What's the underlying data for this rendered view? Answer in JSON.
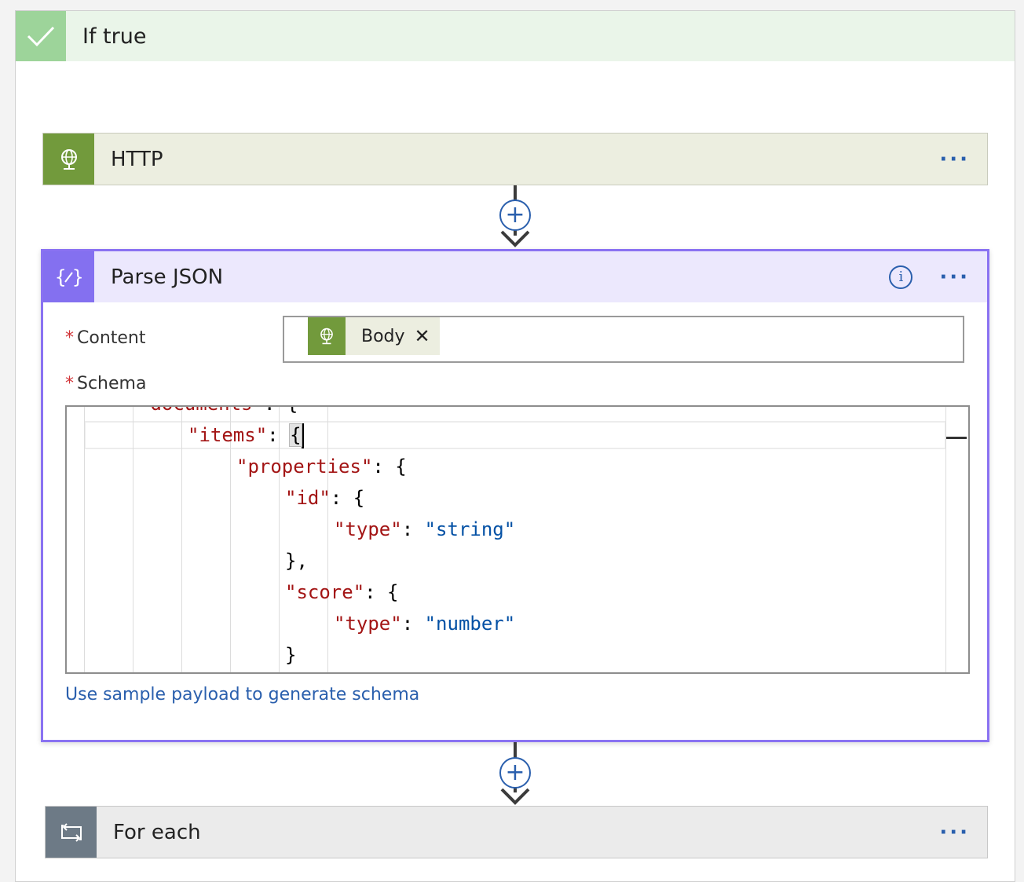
{
  "condition": {
    "title": "If true"
  },
  "http_action": {
    "title": "HTTP",
    "more": "···"
  },
  "parse_action": {
    "title": "Parse JSON",
    "info": "i",
    "more": "···",
    "content_label": "Content",
    "content_token": {
      "label": "Body",
      "remove": "✕"
    },
    "schema_label": "Schema",
    "required_mark": "*",
    "schema_lines": [
      {
        "indent": 2,
        "parts": [
          {
            "c": "k",
            "t": "\"documents\""
          },
          {
            "c": "p",
            "t": ": {"
          }
        ]
      },
      {
        "indent": 3,
        "parts": [
          {
            "c": "k",
            "t": "\"items\""
          },
          {
            "c": "p",
            "t": ": "
          }
        ],
        "bracket": "{"
      },
      {
        "indent": 4,
        "parts": [
          {
            "c": "k",
            "t": "\"properties\""
          },
          {
            "c": "p",
            "t": ": {"
          }
        ]
      },
      {
        "indent": 5,
        "parts": [
          {
            "c": "k",
            "t": "\"id\""
          },
          {
            "c": "p",
            "t": ": {"
          }
        ]
      },
      {
        "indent": 6,
        "parts": [
          {
            "c": "k",
            "t": "\"type\""
          },
          {
            "c": "p",
            "t": ": "
          },
          {
            "c": "s",
            "t": "\"string\""
          }
        ]
      },
      {
        "indent": 5,
        "parts": [
          {
            "c": "p",
            "t": "},"
          }
        ]
      },
      {
        "indent": 5,
        "parts": [
          {
            "c": "k",
            "t": "\"score\""
          },
          {
            "c": "p",
            "t": ": {"
          }
        ]
      },
      {
        "indent": 6,
        "parts": [
          {
            "c": "k",
            "t": "\"type\""
          },
          {
            "c": "p",
            "t": ": "
          },
          {
            "c": "s",
            "t": "\"number\""
          }
        ]
      },
      {
        "indent": 5,
        "parts": [
          {
            "c": "p",
            "t": "}"
          }
        ]
      }
    ],
    "sample_link": "Use sample payload to generate schema"
  },
  "foreach_action": {
    "title": "For each",
    "more": "···"
  },
  "add_step": "+",
  "colors": {
    "http_accent": "#729a3c",
    "parse_accent": "#8470f0",
    "foreach_accent": "#6d7a86",
    "success_accent": "#9dd49a",
    "link": "#2a5fad"
  }
}
